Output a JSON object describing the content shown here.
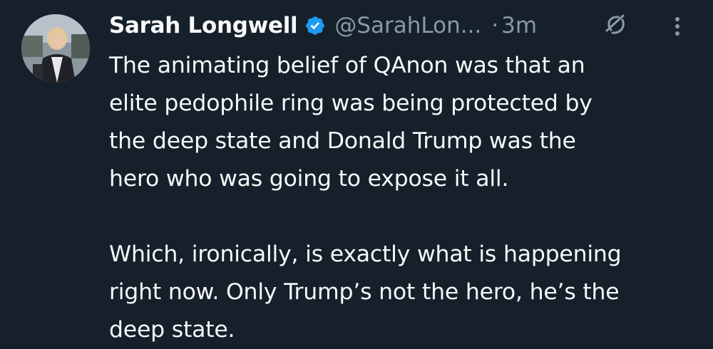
{
  "tweet": {
    "author": {
      "display_name": "Sarah Longwell",
      "handle": "@SarahLon...",
      "verified": true,
      "avatar_icon": "profile-photo"
    },
    "separator": "·",
    "timestamp": "3m",
    "icons": {
      "grok": "grok-icon",
      "more": "more-options-icon"
    },
    "text": "The animating belief of QAnon was that an\nelite pedophile ring was being protected by\nthe deep state and Donald Trump was the\nhero who was going to expose it all.\n\nWhich, ironically, is exactly what is happening\nright now. Only Trump’s not the hero, he’s the\ndeep state."
  },
  "colors": {
    "background": "#15202b",
    "text_primary": "#f7f9f9",
    "text_secondary": "#8b98a5",
    "verified_badge": "#1d9bf0"
  }
}
